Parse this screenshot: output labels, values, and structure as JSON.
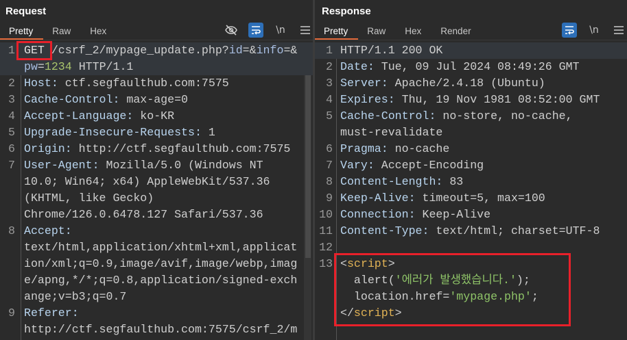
{
  "request": {
    "title": "Request",
    "tabs": [
      "Pretty",
      "Raw",
      "Hex"
    ],
    "active_tab": 0,
    "tools": {
      "hide_icon": "eye-slash-icon",
      "wrap_icon": "wrap-icon",
      "newline_label": "\\n",
      "menu_icon": "hamburger-icon"
    },
    "lines": [
      {
        "num": "1",
        "rows": [
          [
            [
              "GET",
              "m"
            ],
            [
              " /csrf_2/mypage_update.php?",
              "v"
            ],
            [
              "id",
              "p"
            ],
            [
              "=&",
              "v"
            ],
            [
              "info",
              "p"
            ],
            [
              "=&",
              "v"
            ]
          ],
          [
            [
              "pw",
              "p"
            ],
            [
              "=",
              "v"
            ],
            [
              "1234",
              "n"
            ],
            [
              " HTTP/1.1",
              "v"
            ]
          ]
        ]
      },
      {
        "num": "2",
        "rows": [
          [
            [
              "Host:",
              "k"
            ],
            [
              " ctf.segfaulthub.com:7575",
              "v"
            ]
          ]
        ]
      },
      {
        "num": "3",
        "rows": [
          [
            [
              "Cache-Control:",
              "k"
            ],
            [
              " max-age=0",
              "v"
            ]
          ]
        ]
      },
      {
        "num": "4",
        "rows": [
          [
            [
              "Accept-Language:",
              "k"
            ],
            [
              " ko-KR",
              "v"
            ]
          ]
        ]
      },
      {
        "num": "5",
        "rows": [
          [
            [
              "Upgrade-Insecure-Requests:",
              "k"
            ],
            [
              " 1",
              "v"
            ]
          ]
        ]
      },
      {
        "num": "6",
        "rows": [
          [
            [
              "Origin:",
              "k"
            ],
            [
              " http://ctf.segfaulthub.com:7575",
              "v"
            ]
          ]
        ]
      },
      {
        "num": "7",
        "rows": [
          [
            [
              "User-Agent:",
              "k"
            ],
            [
              " Mozilla/5.0 (Windows NT",
              "v"
            ]
          ],
          [
            [
              "10.0; Win64; x64) AppleWebKit/537.36",
              "v"
            ]
          ],
          [
            [
              "(KHTML, like Gecko)",
              "v"
            ]
          ],
          [
            [
              "Chrome/126.0.6478.127 Safari/537.36",
              "v"
            ]
          ]
        ]
      },
      {
        "num": "8",
        "rows": [
          [
            [
              "Accept:",
              "k"
            ]
          ],
          [
            [
              "text/html,application/xhtml+xml,applicat",
              "v"
            ]
          ],
          [
            [
              "ion/xml;q=0.9,image/avif,image/webp,imag",
              "v"
            ]
          ],
          [
            [
              "e/apng,*/*;q=0.8,application/signed-exch",
              "v"
            ]
          ],
          [
            [
              "ange;v=b3;q=0.7",
              "v"
            ]
          ]
        ]
      },
      {
        "num": "9",
        "rows": [
          [
            [
              "Referer:",
              "k"
            ]
          ],
          [
            [
              "http://ctf.segfaulthub.com:7575/csrf_2/m",
              "v"
            ]
          ]
        ]
      }
    ]
  },
  "response": {
    "title": "Response",
    "tabs": [
      "Pretty",
      "Raw",
      "Hex",
      "Render"
    ],
    "active_tab": 0,
    "tools": {
      "wrap_icon": "wrap-icon",
      "newline_label": "\\n",
      "menu_icon": "hamburger-icon"
    },
    "lines": [
      {
        "num": "1",
        "rows": [
          [
            [
              "HTTP/1.1 200 OK",
              "v"
            ]
          ]
        ]
      },
      {
        "num": "2",
        "rows": [
          [
            [
              "Date:",
              "k"
            ],
            [
              " Tue, 09 Jul 2024 08:49:26 GMT",
              "v"
            ]
          ]
        ]
      },
      {
        "num": "3",
        "rows": [
          [
            [
              "Server:",
              "k"
            ],
            [
              " Apache/2.4.18 (Ubuntu)",
              "v"
            ]
          ]
        ]
      },
      {
        "num": "4",
        "rows": [
          [
            [
              "Expires:",
              "k"
            ],
            [
              " Thu, 19 Nov 1981 08:52:00 GMT",
              "v"
            ]
          ]
        ]
      },
      {
        "num": "5",
        "rows": [
          [
            [
              "Cache-Control:",
              "k"
            ],
            [
              " no-store, no-cache,",
              "v"
            ]
          ],
          [
            [
              "must-revalidate",
              "v"
            ]
          ]
        ]
      },
      {
        "num": "6",
        "rows": [
          [
            [
              "Pragma:",
              "k"
            ],
            [
              " no-cache",
              "v"
            ]
          ]
        ]
      },
      {
        "num": "7",
        "rows": [
          [
            [
              "Vary:",
              "k"
            ],
            [
              " Accept-Encoding",
              "v"
            ]
          ]
        ]
      },
      {
        "num": "8",
        "rows": [
          [
            [
              "Content-Length:",
              "k"
            ],
            [
              " 83",
              "v"
            ]
          ]
        ]
      },
      {
        "num": "9",
        "rows": [
          [
            [
              "Keep-Alive:",
              "k"
            ],
            [
              " timeout=5, max=100",
              "v"
            ]
          ]
        ]
      },
      {
        "num": "10",
        "rows": [
          [
            [
              "Connection:",
              "k"
            ],
            [
              " Keep-Alive",
              "v"
            ]
          ]
        ]
      },
      {
        "num": "11",
        "rows": [
          [
            [
              "Content-Type:",
              "k"
            ],
            [
              " text/html; charset=UTF-8",
              "v"
            ]
          ]
        ]
      },
      {
        "num": "12",
        "rows": [
          []
        ]
      },
      {
        "num": "13",
        "rows": [
          [
            [
              "<",
              "v"
            ],
            [
              "script",
              "t"
            ],
            [
              ">",
              "v"
            ]
          ]
        ]
      },
      {
        "num": "",
        "rows": [
          [
            [
              "  alert(",
              "v"
            ],
            [
              "'에러가 발생했습니다.'",
              "s"
            ],
            [
              ");",
              "v"
            ]
          ]
        ]
      },
      {
        "num": "",
        "rows": [
          [
            [
              "  location.href=",
              "v"
            ],
            [
              "'mypage.php'",
              "s"
            ],
            [
              ";",
              "v"
            ]
          ]
        ]
      },
      {
        "num": "",
        "rows": [
          [
            [
              "</",
              "v"
            ],
            [
              "script",
              "t"
            ],
            [
              ">",
              "v"
            ]
          ]
        ]
      }
    ]
  },
  "colors": {
    "accent_tab": "#e2693a",
    "highlight_box": "#e8202a",
    "toggle_on": "#2d6fb8"
  }
}
